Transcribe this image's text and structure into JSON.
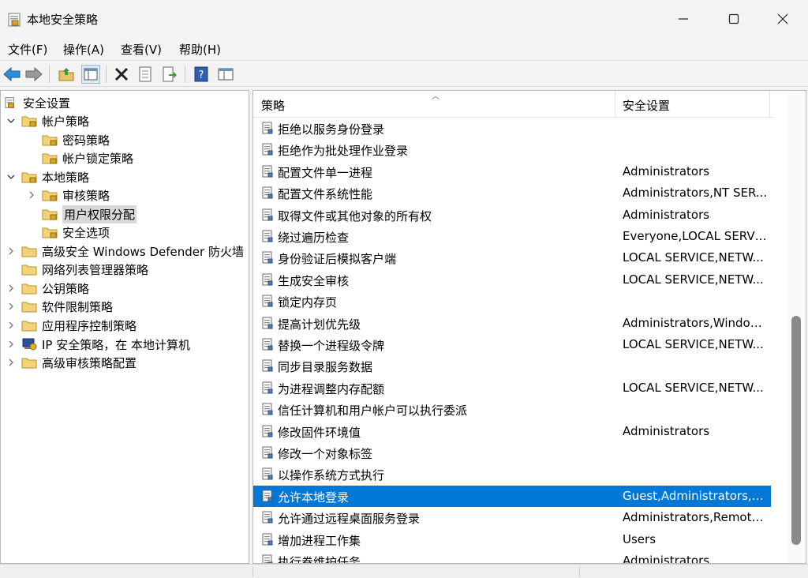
{
  "window": {
    "title": "本地安全策略"
  },
  "menu": [
    "文件(F)",
    "操作(A)",
    "查看(V)",
    "帮助(H)"
  ],
  "toolbar": {
    "buttons": [
      "back-icon",
      "forward-icon",
      "up-folder-icon",
      "show-tree-icon",
      "delete-icon",
      "properties-icon",
      "export-icon",
      "help-icon",
      "view-icon"
    ]
  },
  "tree": {
    "root": "安全设置",
    "items": [
      "帐户策略",
      "密码策略",
      "帐户锁定策略",
      "本地策略",
      "审核策略",
      "用户权限分配",
      "安全选项",
      "高级安全 Windows Defender 防火墙",
      "网络列表管理器策略",
      "公钥策略",
      "软件限制策略",
      "应用程序控制策略",
      "IP 安全策略，在 本地计算机",
      "高级审核策略配置"
    ]
  },
  "list": {
    "col_policy": "策略",
    "col_setting": "安全设置",
    "rows": [
      {
        "name": "拒绝以服务身份登录",
        "value": ""
      },
      {
        "name": "拒绝作为批处理作业登录",
        "value": ""
      },
      {
        "name": "配置文件单一进程",
        "value": "Administrators"
      },
      {
        "name": "配置文件系统性能",
        "value": "Administrators,NT SER..."
      },
      {
        "name": "取得文件或其他对象的所有权",
        "value": "Administrators"
      },
      {
        "name": "绕过遍历检查",
        "value": "Everyone,LOCAL SERVI..."
      },
      {
        "name": "身份验证后模拟客户端",
        "value": "LOCAL SERVICE,NETW..."
      },
      {
        "name": "生成安全审核",
        "value": "LOCAL SERVICE,NETW..."
      },
      {
        "name": "锁定内存页",
        "value": ""
      },
      {
        "name": "提高计划优先级",
        "value": "Administrators,Window ..."
      },
      {
        "name": "替换一个进程级令牌",
        "value": "LOCAL SERVICE,NETW..."
      },
      {
        "name": "同步目录服务数据",
        "value": ""
      },
      {
        "name": "为进程调整内存配额",
        "value": "LOCAL SERVICE,NETW..."
      },
      {
        "name": "信任计算机和用户帐户可以执行委派",
        "value": ""
      },
      {
        "name": "修改固件环境值",
        "value": "Administrators"
      },
      {
        "name": "修改一个对象标签",
        "value": ""
      },
      {
        "name": "以操作系统方式执行",
        "value": ""
      },
      {
        "name": "允许本地登录",
        "value": "Guest,Administrators,U..."
      },
      {
        "name": "允许通过远程桌面服务登录",
        "value": "Administrators,Remote ..."
      },
      {
        "name": "增加进程工作集",
        "value": "Users"
      },
      {
        "name": "执行卷维护任务",
        "value": "Administrators"
      }
    ]
  },
  "colors": {
    "selection": "#0078d7",
    "folder": "#e9c46a"
  }
}
